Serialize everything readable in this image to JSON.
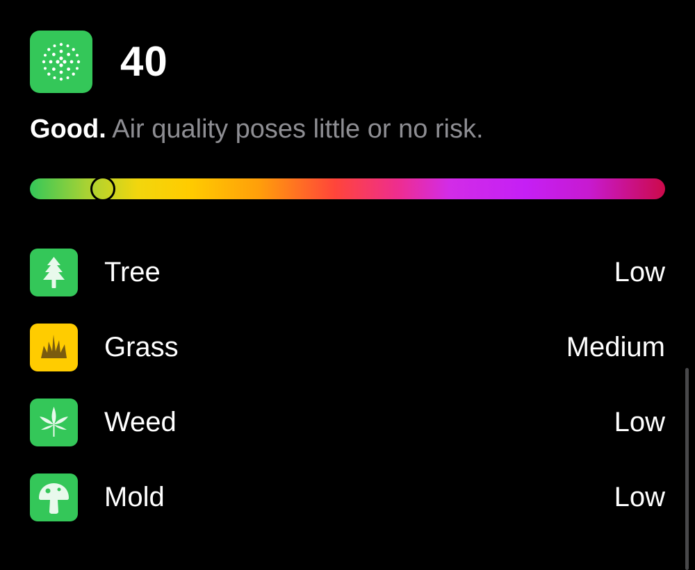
{
  "aqi": {
    "value": "40",
    "category": "Good.",
    "description": " Air quality poses little or no risk.",
    "scale_position": 0.115,
    "icon": "air-quality-dots-icon",
    "color": "#34c759"
  },
  "pollen": [
    {
      "name": "Tree",
      "level": "Low",
      "icon": "tree-icon",
      "color": "#34c759"
    },
    {
      "name": "Grass",
      "level": "Medium",
      "icon": "grass-icon",
      "color": "#ffcc00"
    },
    {
      "name": "Weed",
      "level": "Low",
      "icon": "weed-leaf-icon",
      "color": "#34c759"
    },
    {
      "name": "Mold",
      "level": "Low",
      "icon": "mushroom-icon",
      "color": "#34c759"
    }
  ]
}
